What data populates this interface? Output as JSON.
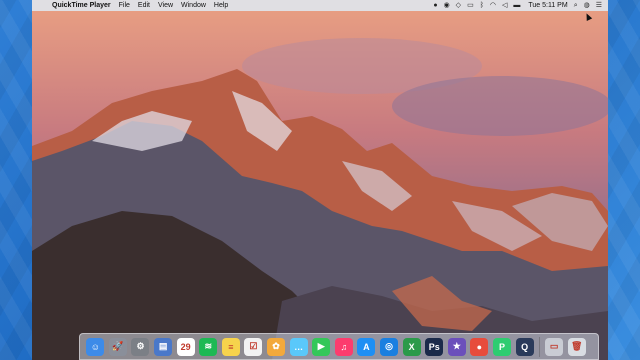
{
  "menubar": {
    "apple_glyph": "",
    "app_name": "QuickTime Player",
    "menus": [
      "File",
      "Edit",
      "View",
      "Window",
      "Help"
    ],
    "tray_icons": [
      "record-icon",
      "eye-icon",
      "dropbox-icon",
      "display-icon",
      "bluetooth-icon",
      "wifi-icon",
      "volume-icon",
      "battery-icon",
      "user-icon",
      "search-icon",
      "siri-icon",
      "notification-center-icon"
    ],
    "clock": "Tue 5:11 PM"
  },
  "dock": {
    "apps": [
      {
        "name": "finder-icon",
        "color": "#3d8be8",
        "glyph": "☺"
      },
      {
        "name": "launchpad-icon",
        "color": "#8a8f9a",
        "glyph": "🚀"
      },
      {
        "name": "system-preferences-icon",
        "color": "#7b7f86",
        "glyph": "⚙"
      },
      {
        "name": "preview-icon",
        "color": "#4a78c9",
        "glyph": "▤"
      },
      {
        "name": "calendar-icon",
        "color": "#ffffff",
        "glyph": "29"
      },
      {
        "name": "spotify-icon",
        "color": "#1db954",
        "glyph": "≋"
      },
      {
        "name": "notes-icon",
        "color": "#f6d34c",
        "glyph": "≡"
      },
      {
        "name": "reminders-icon",
        "color": "#f2f2f2",
        "glyph": "☑"
      },
      {
        "name": "photos-icon",
        "color": "#f3a93b",
        "glyph": "✿"
      },
      {
        "name": "messages-icon",
        "color": "#5ac8fa",
        "glyph": "…"
      },
      {
        "name": "facetime-icon",
        "color": "#34c759",
        "glyph": "▶"
      },
      {
        "name": "itunes-icon",
        "color": "#fc3c6e",
        "glyph": "♫"
      },
      {
        "name": "app-store-icon",
        "color": "#1e8ff4",
        "glyph": "A"
      },
      {
        "name": "safari-icon",
        "color": "#1a7fe0",
        "glyph": "◎"
      },
      {
        "name": "xcode-icon",
        "color": "#2b9a4a",
        "glyph": "X"
      },
      {
        "name": "photoshop-icon",
        "color": "#1b2a4a",
        "glyph": "Ps"
      },
      {
        "name": "imovie-icon",
        "color": "#6b4fbb",
        "glyph": "★"
      },
      {
        "name": "chrome-icon",
        "color": "#e74c3c",
        "glyph": "●"
      },
      {
        "name": "vpn-icon",
        "color": "#2ecc71",
        "glyph": "P"
      },
      {
        "name": "quicktime-icon",
        "color": "#2a3a5a",
        "glyph": "Q"
      },
      {
        "name": "downloads-stack-icon",
        "color": "#c9ccd4",
        "glyph": "▭"
      },
      {
        "name": "trash-icon",
        "color": "#d9dde3",
        "glyph": "🗑"
      }
    ]
  }
}
